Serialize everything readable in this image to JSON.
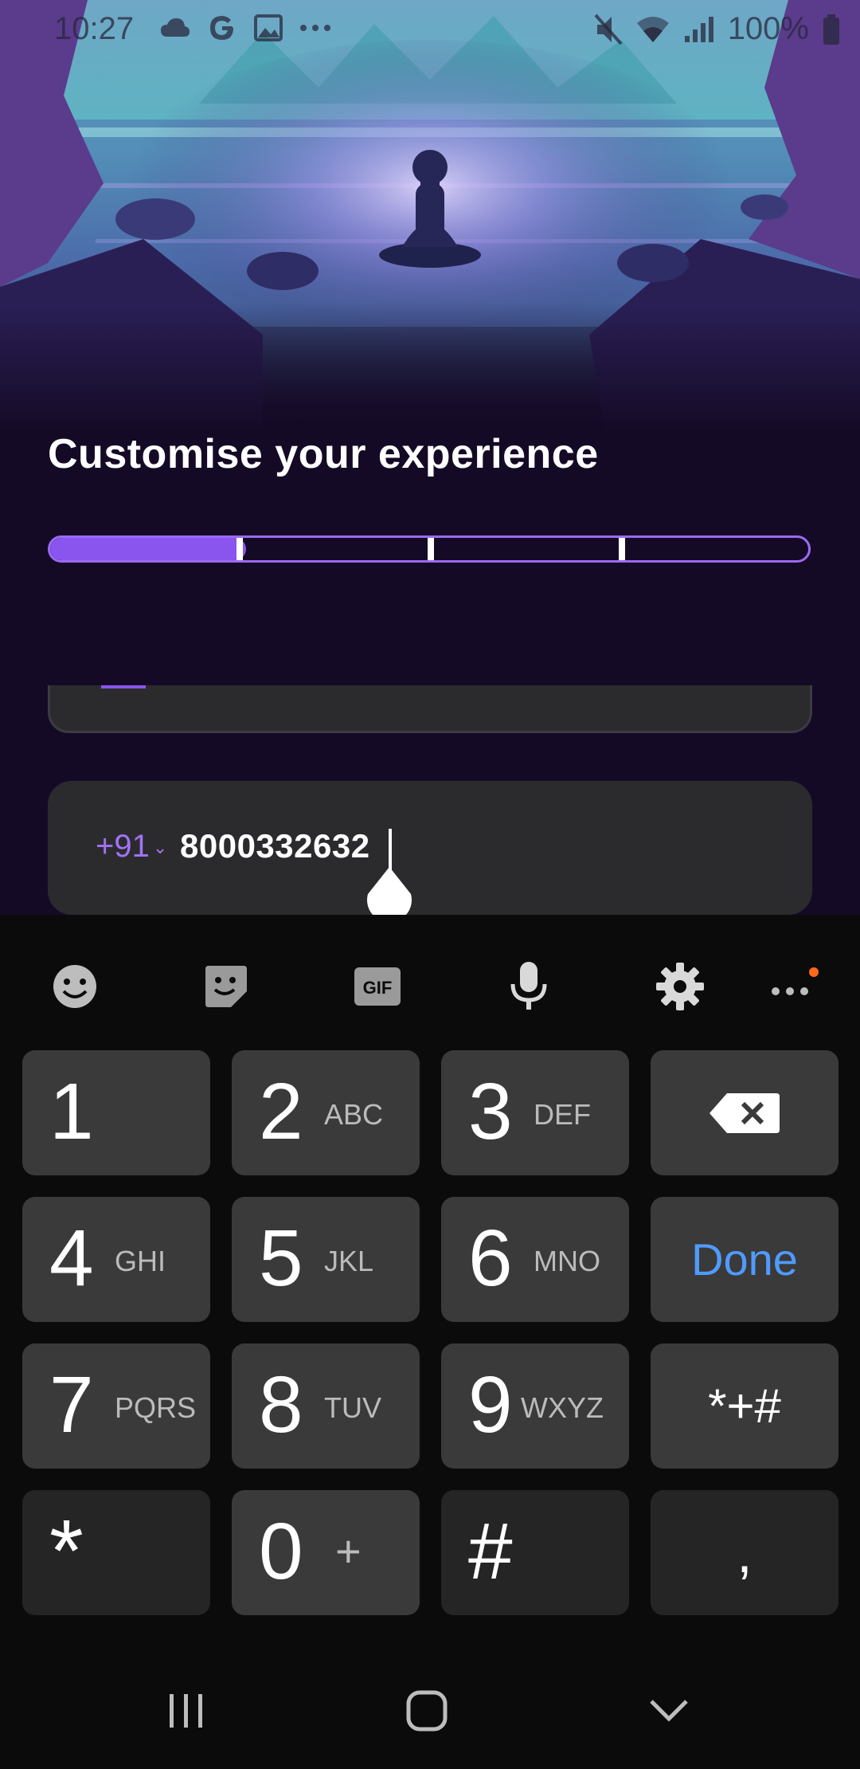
{
  "status_bar": {
    "time": "10:27",
    "battery": "100%",
    "left_icons": [
      "cloud-icon",
      "google-icon",
      "gallery-icon",
      "more-dots-icon"
    ],
    "right_icons": [
      "mute-icon",
      "wifi-icon",
      "signal-icon",
      "battery-icon"
    ]
  },
  "hero": {
    "image": "meditation-landscape-illustration"
  },
  "page": {
    "title": "Customise your experience",
    "progress": {
      "steps": 4,
      "current_step": 1,
      "fraction": 0.25
    }
  },
  "phone_input": {
    "country_code": "+91",
    "value": "8000332632"
  },
  "keyboard": {
    "toolbar": [
      "emoji-icon",
      "sticker-icon",
      "gif-icon",
      "microphone-icon",
      "settings-icon",
      "more-icon"
    ],
    "gif_label": "GIF",
    "keys": {
      "k1": {
        "num": "1",
        "letters": ""
      },
      "k2": {
        "num": "2",
        "letters": "ABC"
      },
      "k3": {
        "num": "3",
        "letters": "DEF"
      },
      "k4": {
        "num": "4",
        "letters": "GHI"
      },
      "k5": {
        "num": "5",
        "letters": "JKL"
      },
      "k6": {
        "num": "6",
        "letters": "MNO"
      },
      "k7": {
        "num": "7",
        "letters": "PQRS"
      },
      "k8": {
        "num": "8",
        "letters": "TUV"
      },
      "k9": {
        "num": "9",
        "letters": "WXYZ"
      },
      "k0": {
        "num": "0",
        "letters": "+"
      },
      "star": "*",
      "hash": "#",
      "comma": ",",
      "symbols": "*+#",
      "done": "Done"
    }
  },
  "colors": {
    "accent": "#8a55ee",
    "done": "#4f9bff",
    "background": "#150a26",
    "notification_dot": "#ff6a1a"
  },
  "nav_bar": [
    "recents-button",
    "home-button",
    "back-button"
  ]
}
